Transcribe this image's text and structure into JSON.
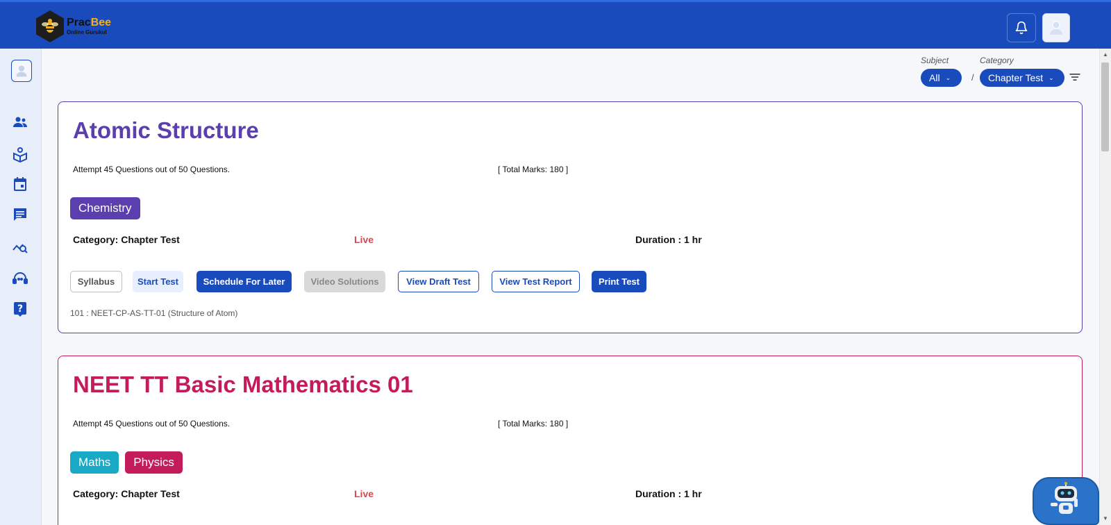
{
  "brand": {
    "name_part1": "Prac",
    "name_part2": "Bee",
    "tagline": "Online Gurukul",
    "colors": {
      "primary": "#1a4bbd",
      "accent": "#f2b01e"
    }
  },
  "header": {
    "notification_icon": "bell-icon",
    "profile_icon": "user-icon"
  },
  "sidebar": {
    "items": [
      {
        "icon": "users-icon"
      },
      {
        "icon": "book-reader-icon"
      },
      {
        "icon": "calendar-icon"
      },
      {
        "icon": "chat-icon"
      },
      {
        "icon": "analytics-search-icon"
      },
      {
        "icon": "support-agent-icon"
      },
      {
        "icon": "help-icon"
      }
    ]
  },
  "filters": {
    "subject_label": "Subject",
    "subject_value": "All",
    "category_label": "Category",
    "category_value": "Chapter Test",
    "separator": "/"
  },
  "tests": [
    {
      "title": "Atomic Structure",
      "attempt_text": "Attempt 45 Questions out of 50 Questions.",
      "marks_text": "[ Total Marks: 180 ]",
      "tags": [
        "Chemistry"
      ],
      "category_text": "Category: Chapter Test",
      "status": "Live",
      "duration_text": "Duration : 1 hr",
      "actions": {
        "syllabus": "Syllabus",
        "start": "Start Test",
        "schedule": "Schedule For Later",
        "video": "Video Solutions",
        "draft": "View Draft Test",
        "report": "View Test Report",
        "print": "Print Test"
      },
      "code": "101 : NEET-CP-AS-TT-01 (Structure of Atom)",
      "color": "#5b3fae"
    },
    {
      "title": "NEET TT Basic Mathematics 01",
      "attempt_text": "Attempt 45 Questions out of 50 Questions.",
      "marks_text": "[ Total Marks: 180 ]",
      "tags": [
        "Maths",
        "Physics"
      ],
      "category_text": "Category: Chapter Test",
      "status": "Live",
      "duration_text": "Duration : 1 hr",
      "color": "#c41c5a"
    }
  ],
  "chatbot": {
    "icon": "robot-icon"
  }
}
